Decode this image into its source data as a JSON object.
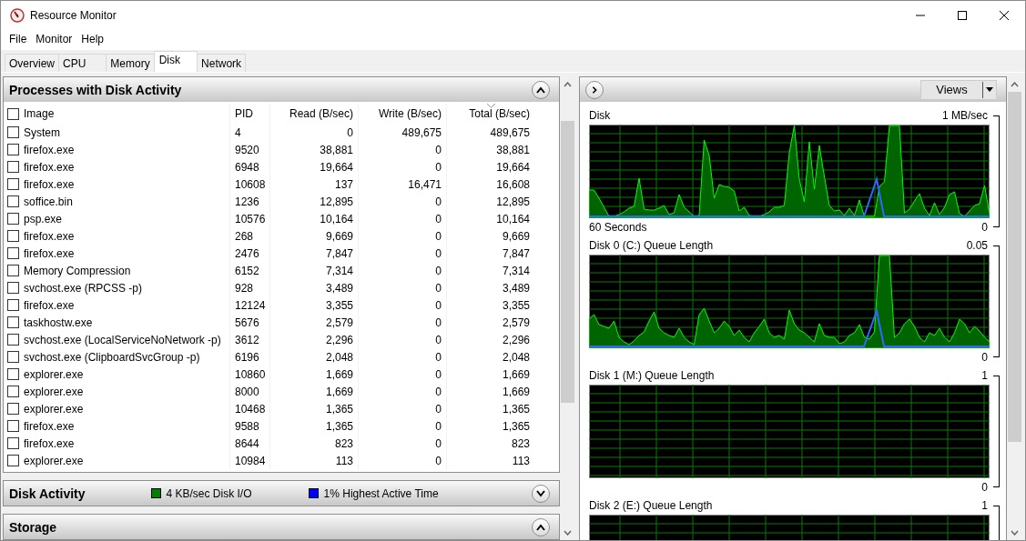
{
  "window": {
    "title": "Resource Monitor"
  },
  "menu": [
    "File",
    "Monitor",
    "Help"
  ],
  "tabs": [
    {
      "label": "Overview",
      "selected": false
    },
    {
      "label": "CPU",
      "selected": false
    },
    {
      "label": "Memory",
      "selected": false
    },
    {
      "label": "Disk",
      "selected": true
    },
    {
      "label": "Network",
      "selected": false
    }
  ],
  "processes": {
    "title": "Processes with Disk Activity",
    "expanded": true,
    "all_checked": false,
    "columns": [
      {
        "label": "Image",
        "sorted": false
      },
      {
        "label": "PID",
        "sorted": false
      },
      {
        "label": "Read (B/sec)",
        "sorted": false
      },
      {
        "label": "Write (B/sec)",
        "sorted": false
      },
      {
        "label": "Total (B/sec)",
        "sorted": true
      }
    ],
    "rows": [
      {
        "checked": false,
        "image": "System",
        "pid": "4",
        "read": "0",
        "write": "489,675",
        "total": "489,675"
      },
      {
        "checked": false,
        "image": "firefox.exe",
        "pid": "9520",
        "read": "38,881",
        "write": "0",
        "total": "38,881"
      },
      {
        "checked": false,
        "image": "firefox.exe",
        "pid": "6948",
        "read": "19,664",
        "write": "0",
        "total": "19,664"
      },
      {
        "checked": false,
        "image": "firefox.exe",
        "pid": "10608",
        "read": "137",
        "write": "16,471",
        "total": "16,608"
      },
      {
        "checked": false,
        "image": "soffice.bin",
        "pid": "1236",
        "read": "12,895",
        "write": "0",
        "total": "12,895"
      },
      {
        "checked": false,
        "image": "psp.exe",
        "pid": "10576",
        "read": "10,164",
        "write": "0",
        "total": "10,164"
      },
      {
        "checked": false,
        "image": "firefox.exe",
        "pid": "268",
        "read": "9,669",
        "write": "0",
        "total": "9,669"
      },
      {
        "checked": false,
        "image": "firefox.exe",
        "pid": "2476",
        "read": "7,847",
        "write": "0",
        "total": "7,847"
      },
      {
        "checked": false,
        "image": "Memory Compression",
        "pid": "6152",
        "read": "7,314",
        "write": "0",
        "total": "7,314"
      },
      {
        "checked": false,
        "image": "svchost.exe (RPCSS -p)",
        "pid": "928",
        "read": "3,489",
        "write": "0",
        "total": "3,489"
      },
      {
        "checked": false,
        "image": "firefox.exe",
        "pid": "12124",
        "read": "3,355",
        "write": "0",
        "total": "3,355"
      },
      {
        "checked": false,
        "image": "taskhostw.exe",
        "pid": "5676",
        "read": "2,579",
        "write": "0",
        "total": "2,579"
      },
      {
        "checked": false,
        "image": "svchost.exe (LocalServiceNoNetwork -p)",
        "pid": "3612",
        "read": "2,296",
        "write": "0",
        "total": "2,296"
      },
      {
        "checked": false,
        "image": "svchost.exe (ClipboardSvcGroup -p)",
        "pid": "6196",
        "read": "2,048",
        "write": "0",
        "total": "2,048"
      },
      {
        "checked": false,
        "image": "explorer.exe",
        "pid": "10860",
        "read": "1,669",
        "write": "0",
        "total": "1,669"
      },
      {
        "checked": false,
        "image": "explorer.exe",
        "pid": "8000",
        "read": "1,669",
        "write": "0",
        "total": "1,669"
      },
      {
        "checked": false,
        "image": "explorer.exe",
        "pid": "10468",
        "read": "1,365",
        "write": "0",
        "total": "1,365"
      },
      {
        "checked": false,
        "image": "firefox.exe",
        "pid": "9588",
        "read": "1,365",
        "write": "0",
        "total": "1,365"
      },
      {
        "checked": false,
        "image": "firefox.exe",
        "pid": "8644",
        "read": "823",
        "write": "0",
        "total": "823"
      },
      {
        "checked": false,
        "image": "explorer.exe",
        "pid": "10984",
        "read": "113",
        "write": "0",
        "total": "113"
      }
    ]
  },
  "disk_activity": {
    "title": "Disk Activity",
    "expanded": false,
    "legend": [
      {
        "label": "4 KB/sec Disk I/O",
        "color": "#008000"
      },
      {
        "label": "1% Highest Active Time",
        "color": "#0000ff"
      }
    ]
  },
  "storage": {
    "title": "Storage",
    "expanded": true
  },
  "graphs_panel": {
    "views_button": "Views",
    "graphs": [
      {
        "kind": "activity",
        "title": "Disk",
        "max": "1 MB/sec",
        "footer": "60 Seconds",
        "min": "0"
      },
      {
        "kind": "queue",
        "title": "Disk 0 (C:) Queue Length",
        "max": "0.05",
        "min": "0"
      },
      {
        "kind": "idle",
        "title": "Disk 1 (M:) Queue Length",
        "max": "1",
        "min": "0"
      },
      {
        "kind": "idle",
        "title": "Disk 2 (E:) Queue Length",
        "max": "1"
      }
    ]
  }
}
